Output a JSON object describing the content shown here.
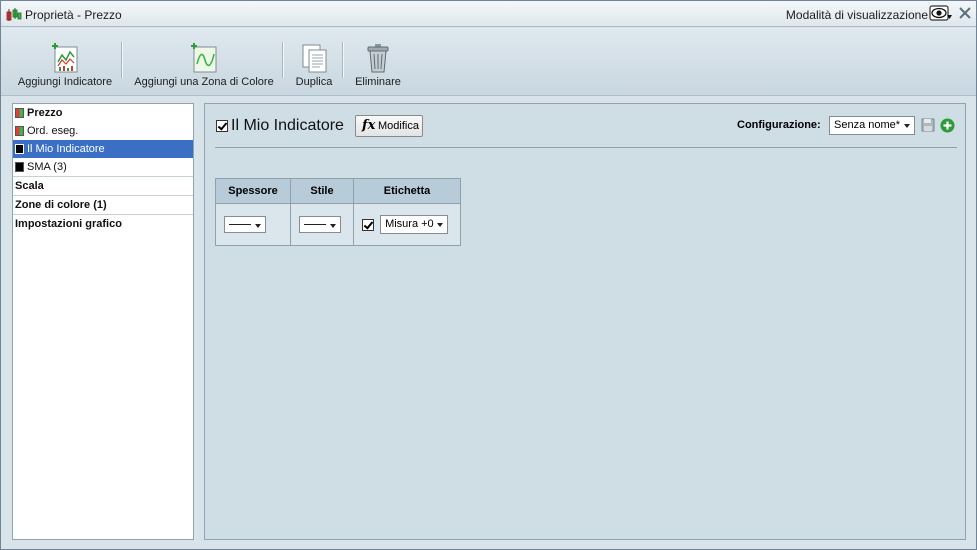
{
  "window": {
    "title": "Proprietà - Prezzo",
    "view_mode_label": "Modalità di visualizzazione"
  },
  "icons": {
    "title": "chart-properties-icon",
    "view_mode": "eye-icon",
    "close": "close-icon",
    "add_indicator": "add-indicator-icon",
    "add_color_zone": "add-color-zone-icon",
    "duplicate": "duplicate-icon",
    "delete": "trash-icon",
    "save_config": "save-icon",
    "add_config": "add-icon"
  },
  "toolbar": {
    "add_indicator_label": "Aggiungi Indicatore",
    "add_color_zone_label": "Aggiungi una Zona di Colore",
    "duplicate_label": "Duplica",
    "delete_label": "Eliminare"
  },
  "tree": {
    "items": [
      {
        "label": "Prezzo",
        "color_a": "#e23b3b",
        "color_b": "#3bb54a",
        "bold": true
      },
      {
        "label": "Ord. eseg.",
        "color_a": "#e23b3b",
        "color_b": "#3bb54a",
        "bold": false
      },
      {
        "label": "Il Mio Indicatore",
        "color_a": "#000000",
        "color_b": "#000000",
        "selected": true
      },
      {
        "label": "SMA (3)",
        "color_a": "#000000",
        "color_b": "#000000",
        "bold": false
      }
    ],
    "groups": [
      {
        "label": "Scala"
      },
      {
        "label": "Zone di colore (1)"
      },
      {
        "label": "Impostazioni grafico"
      }
    ]
  },
  "editor": {
    "indicator_name": "Il Mio Indicatore",
    "indicator_enabled": true,
    "modify_label": "Modifica",
    "fx_glyph": "fx",
    "configuration_label": "Configurazione:",
    "configuration_value": "Senza nome*",
    "table": {
      "headers": [
        "Spessore",
        "Stile",
        "Etichetta"
      ],
      "label_enabled": true,
      "label_value": "Misura +0"
    }
  },
  "colors": {
    "selection": "#3b6fc4",
    "panel_bg": "#cfdde5",
    "header_bg": "#b8cbd8",
    "add_green": "#2e9b3a"
  }
}
